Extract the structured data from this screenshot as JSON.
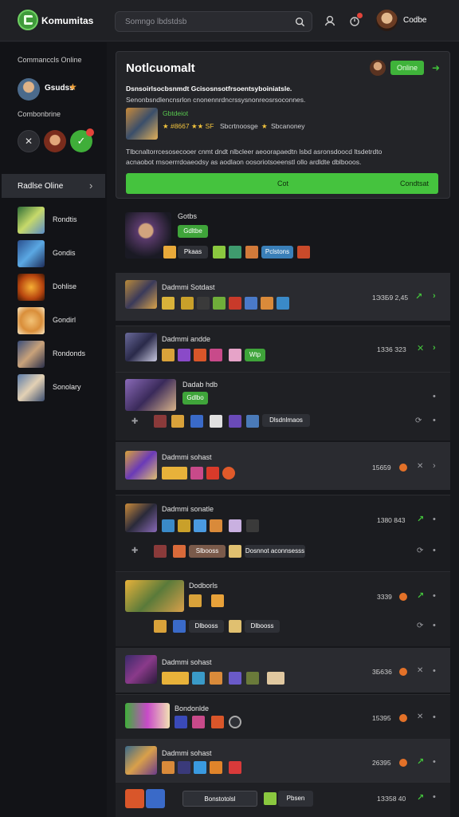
{
  "app": {
    "title": "Komumitas"
  },
  "search": {
    "placeholder": "Somngo lbdstdsb"
  },
  "user": {
    "name": "Codbe"
  },
  "sidebar": {
    "section1": "Commanccls Online",
    "friend_label": "Gsudss",
    "section2": "Combonbrine",
    "online_label": "Radlse Oline",
    "games": [
      "Rondtis",
      "Gondis",
      "Dohlise",
      "Gondirl",
      "Rondonds",
      "Sonolary"
    ]
  },
  "notification": {
    "title": "Notlcuomalt",
    "status": "Online",
    "line1": "Dsnsoirlsocbsnmdt Gcisosnsotfrsoentsyboiniatsle.",
    "line2": "Senonbsndlencnsrlon cnonennrdncrssysnonreosrsoconnes.",
    "game_name": "Gbtdeiot",
    "rating": "★ #8667 ★★ SF",
    "meta1": "Sbcrtnoosge",
    "meta2": "Sbcanoney",
    "desc1": "Tlbcnaltorrcesosecooer cnmt dndt nlbcleer aeoorapaedtn lsbd asronsdoocd ltsdetrdto",
    "desc2": "acnaobot rnsoerrrdoaeodsy as aodlaon oosoriotsoeenstl ollo ardldte dblbooos.",
    "action_left": "Cot",
    "action_right": "Condtsat"
  },
  "feed": [
    {
      "title": "Gotbs",
      "tag": "Gdltbe",
      "chip": "Pkaas",
      "chip2": "Pclstons"
    },
    {
      "title": "Dadmmi Sotdast",
      "num": "1ЭЗБ9 2,45"
    },
    {
      "title": "Dadmmi andde",
      "num": "1ЗЗ6 З23",
      "badge": "Wtp"
    },
    {
      "title": "Dadab hdb",
      "tag": "Gdlbo",
      "chip": "Dlsdnlmaos"
    },
    {
      "title": "Dadmmi sohast",
      "num": "15659"
    },
    {
      "title": "Dadmmi sonatle",
      "num": "1380 843",
      "chip": "Slbooss",
      "chip2": "Dosnnot aconnsesss"
    },
    {
      "title": "Dodborls",
      "num": "3339",
      "chip": "Dlbooss",
      "chip2": "Dlbooss"
    },
    {
      "title": "Dadmmi sohast",
      "num": "3Б6З6"
    },
    {
      "title": "Bondonlde",
      "num": "15395"
    },
    {
      "title": "Dadmmi sohast",
      "num": "26395"
    },
    {
      "title": "",
      "chip": "Bonstotolsl",
      "chip2": "Pbsen",
      "num": "1ЗЗ58 40"
    }
  ]
}
